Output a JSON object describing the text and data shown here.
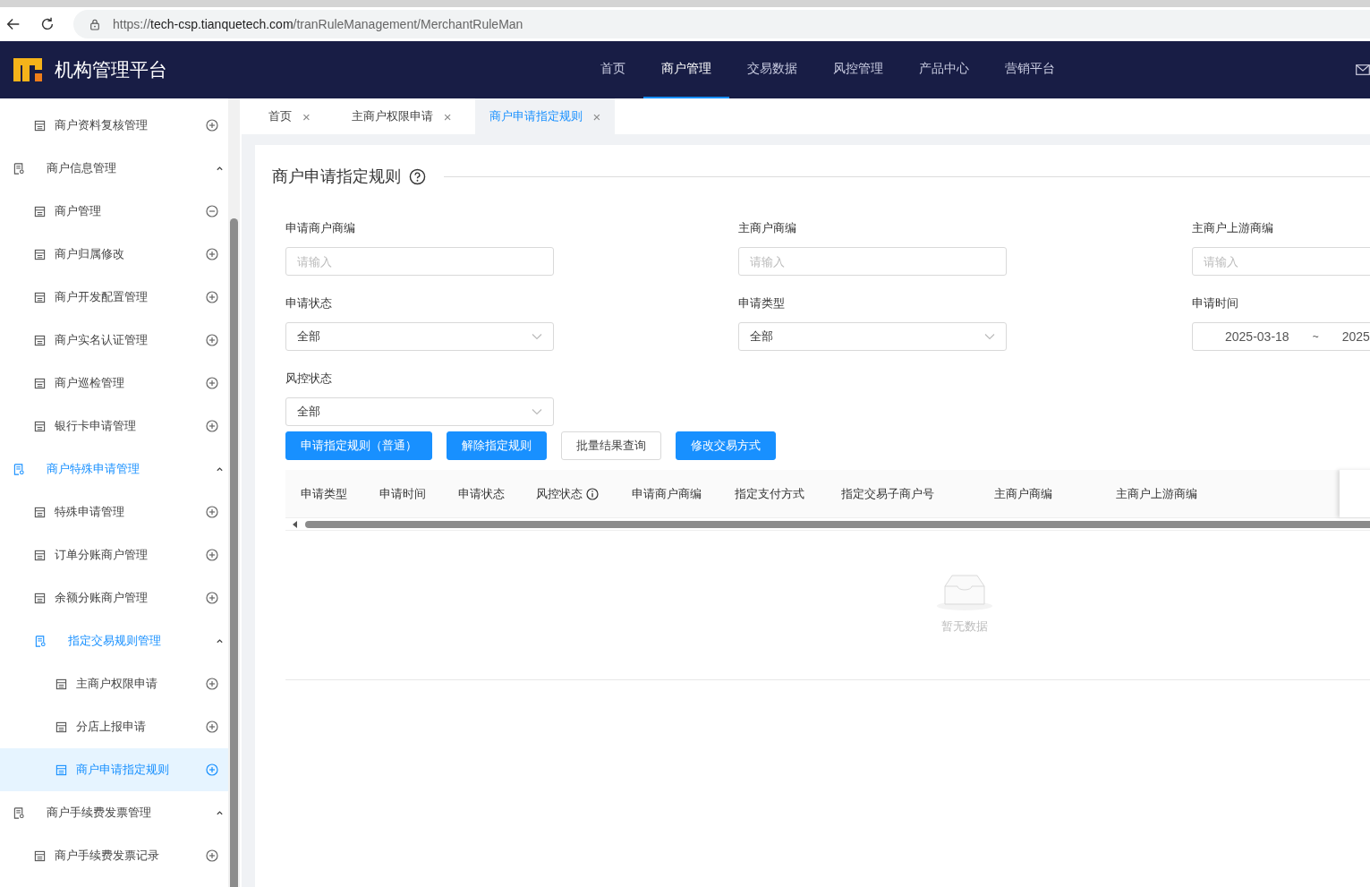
{
  "browser": {
    "url": {
      "scheme": "https://",
      "host": "tech-csp.tianquetech.com",
      "path": "/tranRuleManagement/MerchantRuleMan"
    }
  },
  "header": {
    "app_title": "机构管理平台",
    "nav": [
      {
        "label": "首页",
        "selected": false
      },
      {
        "label": "商户管理",
        "selected": true
      },
      {
        "label": "交易数据",
        "selected": false
      },
      {
        "label": "风控管理",
        "selected": false
      },
      {
        "label": "产品中心",
        "selected": false
      },
      {
        "label": "营销平台",
        "selected": false
      }
    ]
  },
  "sidebar": {
    "items": [
      {
        "kind": "leaf",
        "label": "商户资料复核管理",
        "expanded": false,
        "selected": false
      },
      {
        "kind": "group",
        "label": "商户信息管理",
        "expanded": true,
        "active": false,
        "children": [
          {
            "kind": "leaf",
            "label": "商户管理",
            "expanded": true,
            "selected": false
          },
          {
            "kind": "leaf",
            "label": "商户归属修改",
            "expanded": false,
            "selected": false
          },
          {
            "kind": "leaf",
            "label": "商户开发配置管理",
            "expanded": false,
            "selected": false
          },
          {
            "kind": "leaf",
            "label": "商户实名认证管理",
            "expanded": false,
            "selected": false
          },
          {
            "kind": "leaf",
            "label": "商户巡检管理",
            "expanded": false,
            "selected": false
          },
          {
            "kind": "leaf",
            "label": "银行卡申请管理",
            "expanded": false,
            "selected": false
          }
        ]
      },
      {
        "kind": "group",
        "label": "商户特殊申请管理",
        "expanded": true,
        "active": true,
        "children": [
          {
            "kind": "leaf",
            "label": "特殊申请管理",
            "expanded": false,
            "selected": false
          },
          {
            "kind": "leaf",
            "label": "订单分账商户管理",
            "expanded": false,
            "selected": false
          },
          {
            "kind": "leaf",
            "label": "余额分账商户管理",
            "expanded": false,
            "selected": false
          },
          {
            "kind": "group",
            "label": "指定交易规则管理",
            "expanded": true,
            "active": true,
            "children": [
              {
                "kind": "leaf",
                "label": "主商户权限申请",
                "expanded": false,
                "selected": false
              },
              {
                "kind": "leaf",
                "label": "分店上报申请",
                "expanded": false,
                "selected": false
              },
              {
                "kind": "leaf",
                "label": "商户申请指定规则",
                "expanded": false,
                "selected": true
              }
            ]
          }
        ]
      },
      {
        "kind": "group",
        "label": "商户手续费发票管理",
        "expanded": true,
        "active": false,
        "children": [
          {
            "kind": "leaf",
            "label": "商户手续费发票记录",
            "expanded": false,
            "selected": false
          }
        ]
      }
    ]
  },
  "tabs": [
    {
      "label": "首页",
      "close": "×",
      "selected": false
    },
    {
      "label": "主商户权限申请",
      "close": "×",
      "selected": false
    },
    {
      "label": "商户申请指定规则",
      "close": "×",
      "selected": true
    }
  ],
  "page": {
    "title": "商户申请指定规则",
    "filters": [
      {
        "kind": "text",
        "label": "申请商户商编",
        "placeholder": "请输入"
      },
      {
        "kind": "text",
        "label": "主商户商编",
        "placeholder": "请输入"
      },
      {
        "kind": "text",
        "label": "主商户上游商编",
        "placeholder": "请输入"
      },
      {
        "kind": "select",
        "label": "申请状态",
        "value": "全部"
      },
      {
        "kind": "select",
        "label": "申请类型",
        "value": "全部"
      },
      {
        "kind": "date_range",
        "label": "申请时间",
        "start": "2025-03-18",
        "separator": "~",
        "end": "2025"
      },
      {
        "kind": "select",
        "label": "风控状态",
        "value": "全部"
      }
    ],
    "buttons": [
      {
        "kind": "primary",
        "label": "申请指定规则（普通）"
      },
      {
        "kind": "primary",
        "label": "解除指定规则"
      },
      {
        "kind": "default",
        "label": "批量结果查询"
      },
      {
        "kind": "primary",
        "label": "修改交易方式"
      }
    ],
    "table": {
      "columns": [
        {
          "label": "申请类型",
          "info": false
        },
        {
          "label": "申请时间",
          "info": false
        },
        {
          "label": "申请状态",
          "info": false
        },
        {
          "label": "风控状态",
          "info": true
        },
        {
          "label": "申请商户商编",
          "info": false
        },
        {
          "label": "指定支付方式",
          "info": false
        },
        {
          "label": "指定交易子商户号",
          "info": false
        },
        {
          "label": "主商户商编",
          "info": false
        },
        {
          "label": "主商户上游商编",
          "info": false
        }
      ],
      "empty_text": "暂无数据"
    }
  }
}
